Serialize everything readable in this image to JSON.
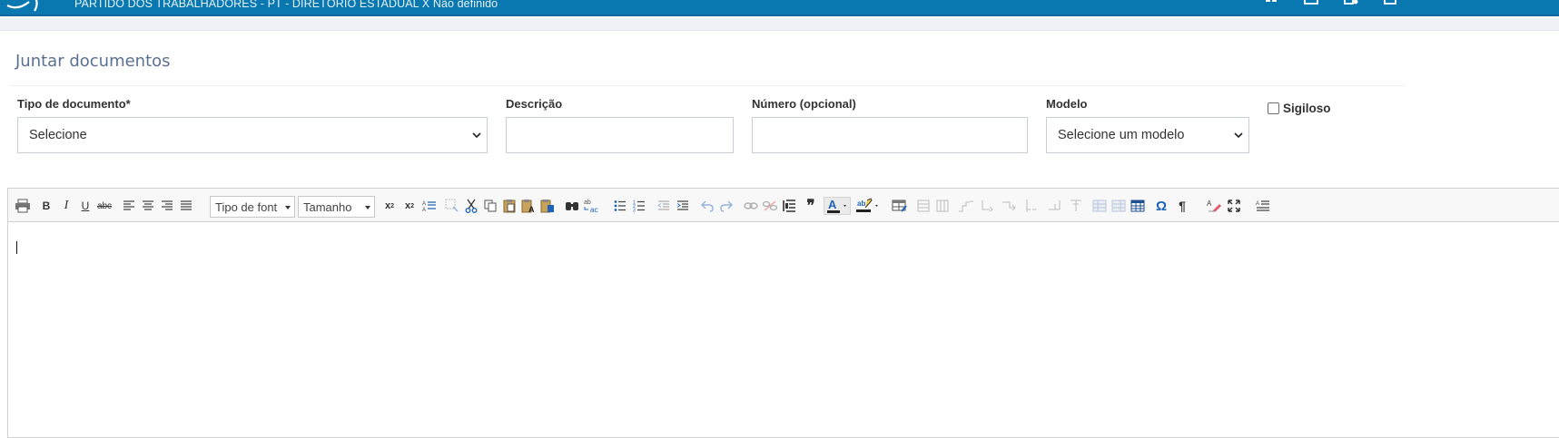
{
  "header": {
    "org_name": "PARTIDO DOS TRABALHADORES - PT - DIRETÓRIO ESTADUAL X Não definido",
    "icons": [
      "sitemap-icon",
      "monitor-icon",
      "user-settings-icon",
      "document-icon"
    ]
  },
  "page": {
    "section_title": "Juntar documentos"
  },
  "form": {
    "tipo_documento": {
      "label": "Tipo de documento*",
      "value": "Selecione"
    },
    "descricao": {
      "label": "Descrição",
      "value": ""
    },
    "numero": {
      "label": "Número (opcional)",
      "value": ""
    },
    "modelo": {
      "label": "Modelo",
      "value": "Selecione um modelo"
    },
    "sigiloso": {
      "label": "Sigiloso",
      "checked": false
    }
  },
  "editor": {
    "font_family_combo": "Tipo de font",
    "font_size_combo": "Tamanho",
    "bold": "B",
    "italic": "I",
    "underline": "U",
    "strike": "abc",
    "omega": "Ω",
    "pilcrow": "¶",
    "content": ""
  },
  "colors": {
    "topbar": "#0a78b0",
    "title": "#5a7093",
    "icon_blue": "#1e63b5"
  }
}
